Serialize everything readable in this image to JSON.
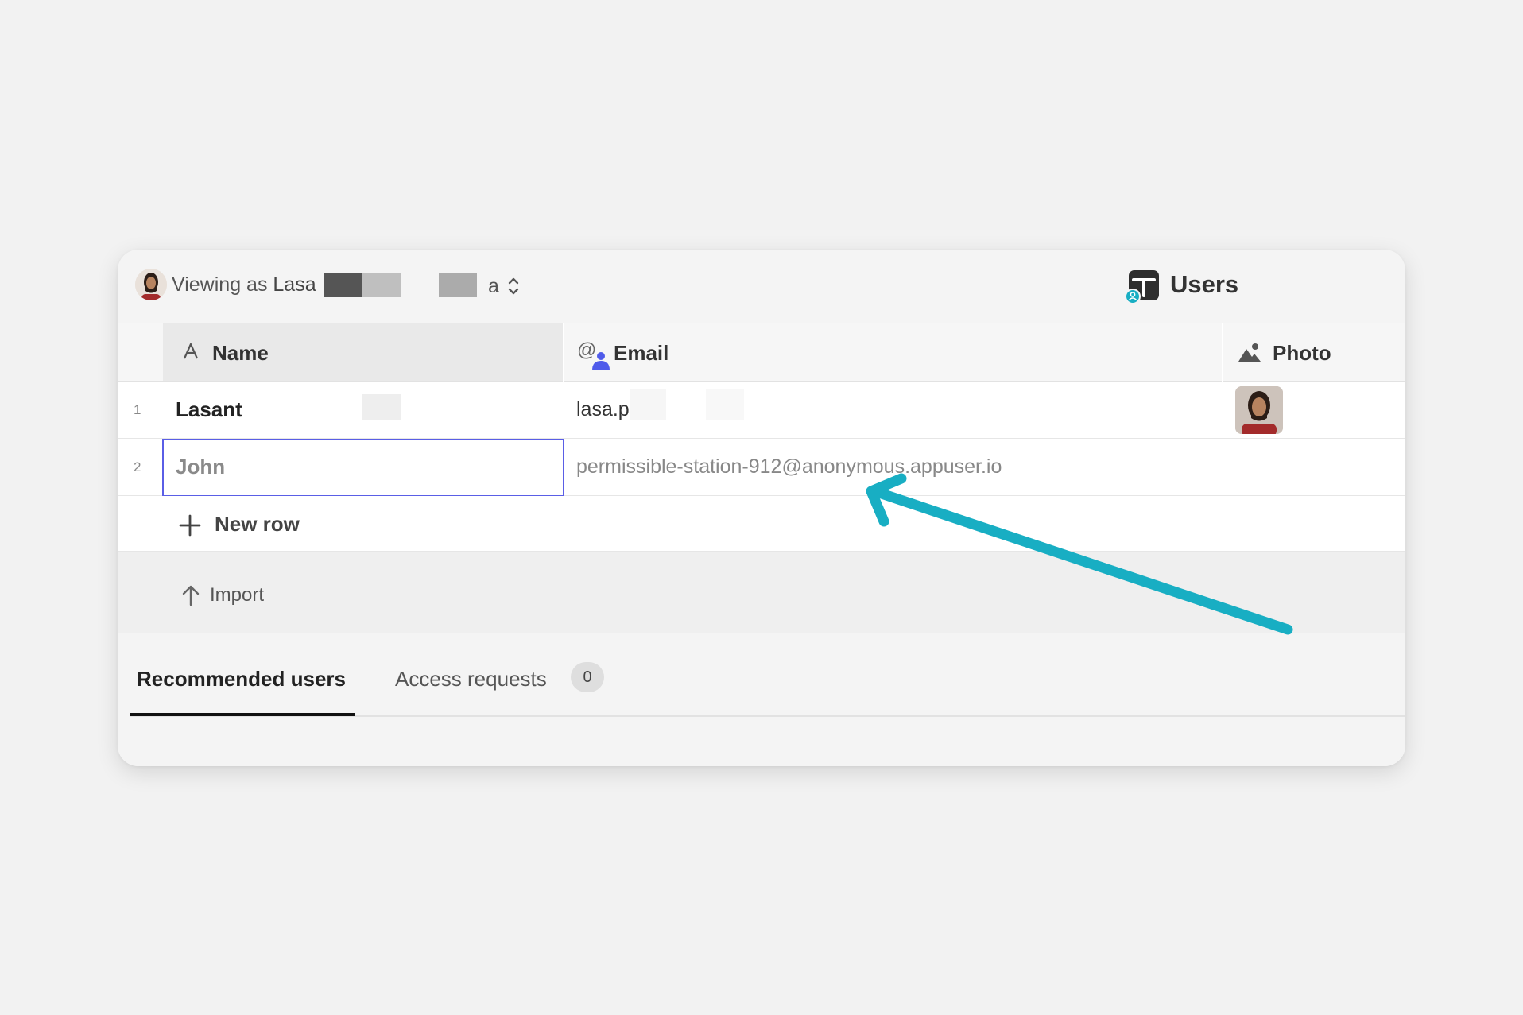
{
  "topbar": {
    "viewing_prefix": "Viewing as ",
    "viewing_name": "Lasa",
    "viewing_tail": "a",
    "app_title": "Users"
  },
  "table": {
    "columns": [
      {
        "label": "Name",
        "icon": "text-type-icon"
      },
      {
        "label": "Email",
        "icon": "email-user-icon"
      },
      {
        "label": "Photo",
        "icon": "image-icon"
      }
    ],
    "rows": [
      {
        "index": "1",
        "name": "Lasant",
        "email": "lasa.p"
      },
      {
        "index": "2",
        "name": "John",
        "email": "permissible-station-912@anonymous.appuser.io"
      }
    ],
    "new_row_label": "New row"
  },
  "import_label": "Import",
  "tabs": {
    "recommended": "Recommended users",
    "access_requests": "Access requests",
    "access_requests_count": "0"
  },
  "colors": {
    "selection": "#5a5ee6",
    "annotation_arrow": "#18aec3",
    "email_icon_accent": "#4f5bea"
  }
}
